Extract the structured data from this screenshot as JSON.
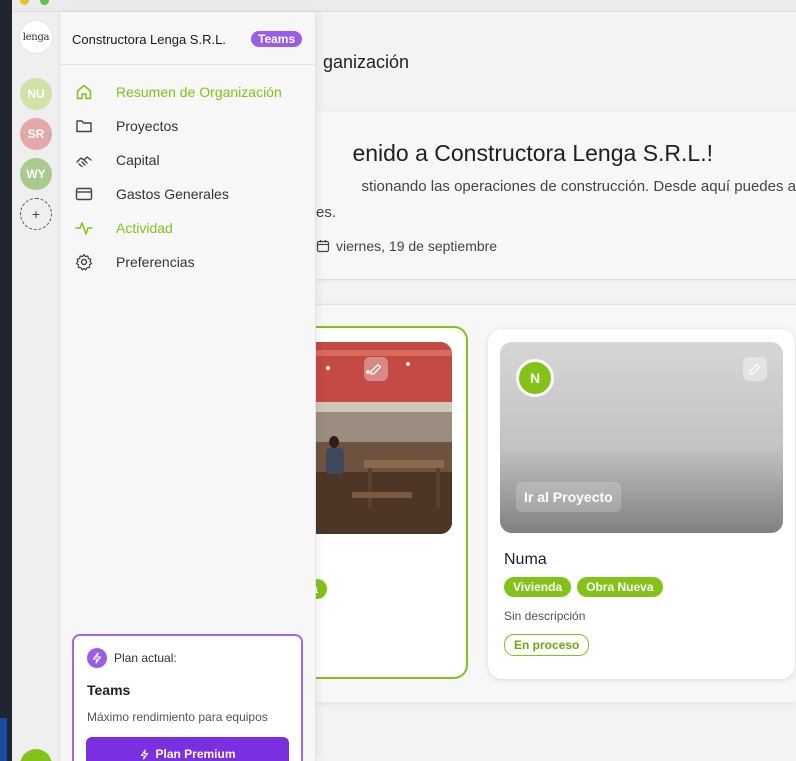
{
  "colors": {
    "accent": "#84c21a",
    "teams": "#9b5de5",
    "premium": "#7a30e0"
  },
  "rail": {
    "logo_text": "lenga",
    "avatars": [
      {
        "initials": "NU",
        "color": "#cfe3a8"
      },
      {
        "initials": "SR",
        "color": "#e3a8a8"
      },
      {
        "initials": "WY",
        "color": "#a9c98f"
      }
    ],
    "add_label": "+"
  },
  "sidebar": {
    "org_name": "Constructora Lenga S.R.L.",
    "badge": "Teams",
    "items": [
      {
        "label": "Resumen de Organización",
        "icon": "home-icon",
        "active": true
      },
      {
        "label": "Proyectos",
        "icon": "folder-icon",
        "active": false
      },
      {
        "label": "Capital",
        "icon": "handshake-icon",
        "active": false
      },
      {
        "label": "Gastos Generales",
        "icon": "credit-card-icon",
        "active": false
      },
      {
        "label": "Actividad",
        "icon": "activity-icon",
        "active": true
      },
      {
        "label": "Preferencias",
        "icon": "gear-icon",
        "active": false
      }
    ],
    "plan": {
      "label": "Plan actual:",
      "name": "Teams",
      "description": "Máximo rendimiento para equipos",
      "button": "Plan Premium"
    }
  },
  "main": {
    "page_title": "ganización",
    "welcome_title": "enido a Constructora Lenga S.R.L.!",
    "welcome_sub": "stionando las operaciones de construcción. Desde aquí puedes a",
    "welcome_sub2": "es.",
    "date": "viernes, 19 de septiembre"
  },
  "projects": [
    {
      "name_fragment": ":",
      "tag_fragment": "eva"
    },
    {
      "initial": "N",
      "go_button": "Ir al Proyecto",
      "name": "Numa",
      "tags": [
        "Vivienda",
        "Obra Nueva"
      ],
      "description": "Sin descripción",
      "status": "En proceso"
    }
  ]
}
